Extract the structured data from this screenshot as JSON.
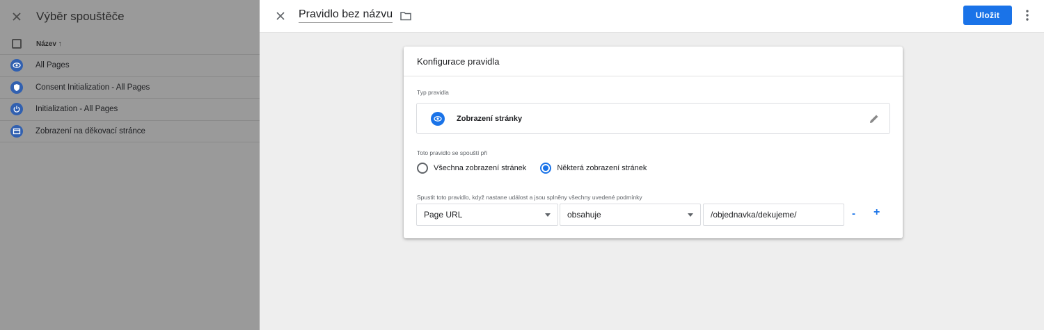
{
  "left_panel": {
    "title": "Výběr spouštěče",
    "column_header": "Název ↑",
    "rows": [
      {
        "label": "All Pages",
        "icon": "eye-icon"
      },
      {
        "label": "Consent Initialization - All Pages",
        "icon": "shield-icon"
      },
      {
        "label": "Initialization - All Pages",
        "icon": "power-icon"
      },
      {
        "label": "Zobrazení na děkovací stránce",
        "icon": "window-icon"
      }
    ]
  },
  "header": {
    "title": "Pravidlo bez názvu",
    "save_label": "Uložit"
  },
  "card": {
    "title": "Konfigurace pravidla",
    "type_label": "Typ pravidla",
    "type_value": "Zobrazení stránky",
    "fires_on_label": "Toto pravidlo se spouští při",
    "radio_all": "Všechna zobrazení stránek",
    "radio_some": "Některá zobrazení stránek",
    "condition_label": "Spustit toto pravidlo, když nastane událost a jsou splněny všechny uvedené podmínky",
    "condition": {
      "variable": "Page URL",
      "operator": "obsahuje",
      "value": "/objednavka/dekujeme/"
    },
    "minus": "-",
    "plus": "+"
  },
  "colors": {
    "accent": "#1a73e8",
    "left_icon": "#3160b0"
  }
}
